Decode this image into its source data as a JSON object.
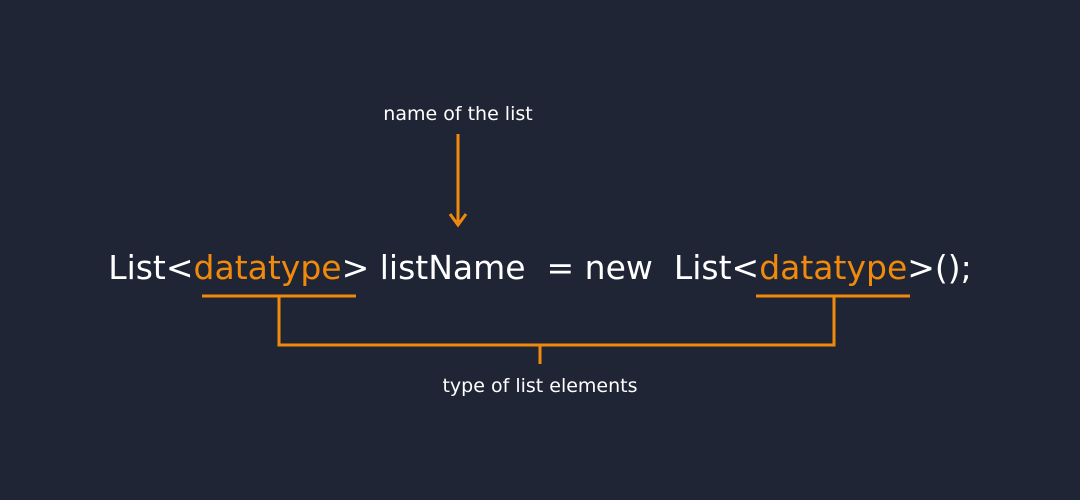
{
  "annotations": {
    "top": "name of the list",
    "bottom": "type of list elements"
  },
  "code": {
    "part1": "List<",
    "type1": "datatype",
    "part2": "> listName  = new  List<",
    "type2": "datatype",
    "part3": ">();"
  },
  "colors": {
    "background": "#1f2535",
    "text": "#ffffff",
    "accent": "#f08a0c"
  }
}
